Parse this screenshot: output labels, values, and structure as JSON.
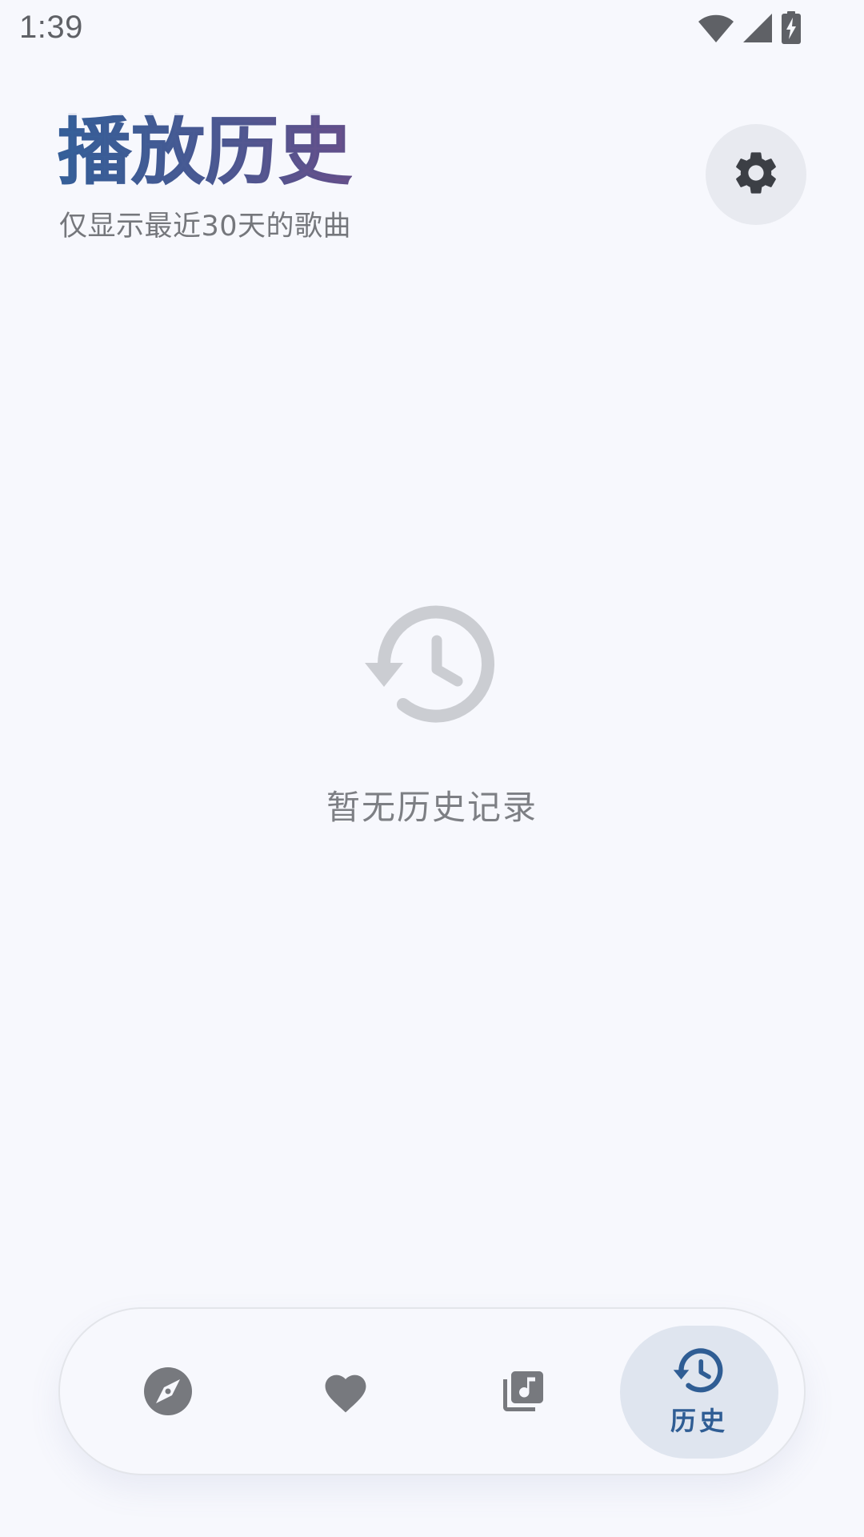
{
  "status_bar": {
    "time": "1:39",
    "icons": [
      "wifi-icon",
      "signal-icon",
      "battery-charging-icon"
    ]
  },
  "header": {
    "title": "播放历史",
    "subtitle": "仅显示最近30天的歌曲",
    "settings_icon": "gear-icon"
  },
  "empty_state": {
    "icon": "history-icon",
    "message": "暂无历史记录"
  },
  "bottom_nav": {
    "items": [
      {
        "icon": "compass-icon",
        "label": "",
        "active": false
      },
      {
        "icon": "heart-icon",
        "label": "",
        "active": false
      },
      {
        "icon": "music-library-icon",
        "label": "",
        "active": false
      },
      {
        "icon": "history-icon",
        "label": "历史",
        "active": true
      }
    ]
  },
  "colors": {
    "background": "#f7f8fd",
    "accent": "#2f5d94",
    "title_gradient_start": "#34619a",
    "title_gradient_end": "#6a4f8a",
    "icon_inactive": "#77797e",
    "empty_icon": "#cbcdd2"
  }
}
